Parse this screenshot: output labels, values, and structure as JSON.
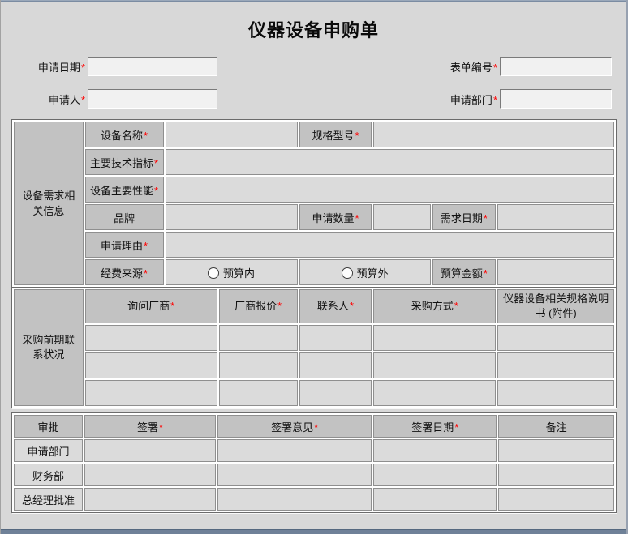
{
  "window": {
    "title": "仪器设备申购单"
  },
  "marks": {
    "required": "*"
  },
  "colors": {
    "required_mark": "#ff0000",
    "header_cell": "#c2c2c2",
    "input_cell": "#dbdbdb",
    "window_bar": "#7b8ca2",
    "page_background": "#d8d8d8"
  },
  "top_fields": {
    "apply_date": {
      "label": "申请日期",
      "required": true,
      "value": ""
    },
    "form_no": {
      "label": "表单编号",
      "required": true,
      "value": ""
    },
    "applicant": {
      "label": "申请人",
      "required": true,
      "value": ""
    },
    "apply_dept": {
      "label": "申请部门",
      "required": true,
      "value": ""
    }
  },
  "equipment_section": {
    "group_label": "设备需求相关信息",
    "fields": {
      "device_name": {
        "label": "设备名称",
        "required": true
      },
      "spec_model": {
        "label": "规格型号",
        "required": true
      },
      "tech_specs": {
        "label": "主要技术指标",
        "required": true
      },
      "main_performance": {
        "label": "设备主要性能",
        "required": true
      },
      "brand": {
        "label": "品牌",
        "required": false
      },
      "quantity": {
        "label": "申请数量",
        "required": true
      },
      "need_date": {
        "label": "需求日期",
        "required": true
      },
      "reason": {
        "label": "申请理由",
        "required": true
      },
      "funding_source": {
        "label": "经费来源",
        "required": true
      },
      "budget_amount": {
        "label": "预算金额",
        "required": true
      }
    },
    "funding_options": [
      {
        "label": "预算内",
        "checked": false
      },
      {
        "label": "预算外",
        "checked": false
      }
    ]
  },
  "procurement_section": {
    "group_label": "采购前期联系状况",
    "headers": [
      {
        "label": "询问厂商",
        "required": true
      },
      {
        "label": "厂商报价",
        "required": true
      },
      {
        "label": "联系人",
        "required": true
      },
      {
        "label": "采购方式",
        "required": true
      },
      {
        "label": "仪器设备相关规格说明书 (附件)",
        "required": false
      }
    ]
  },
  "approval_section": {
    "corner_label": "审批",
    "headers": [
      {
        "label": "签署",
        "required": true
      },
      {
        "label": "签署意见",
        "required": true
      },
      {
        "label": "签署日期",
        "required": true
      },
      {
        "label": "备注",
        "required": false
      }
    ],
    "rows": [
      {
        "label": "申请部门"
      },
      {
        "label": "财务部"
      },
      {
        "label": "总经理批准"
      }
    ]
  }
}
